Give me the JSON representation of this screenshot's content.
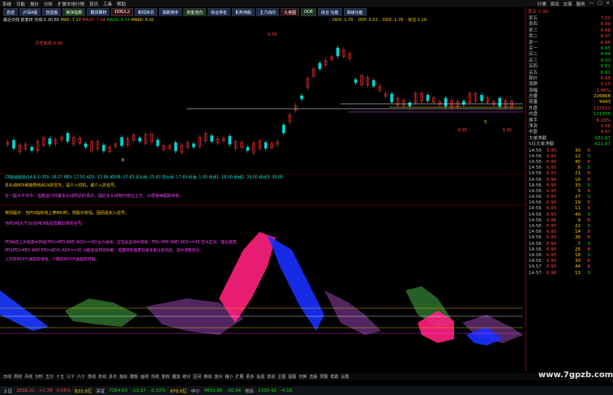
{
  "menubar": {
    "items": [
      "系统",
      "功能",
      "报价",
      "分析",
      "扩展市场行情",
      "资讯",
      "工具",
      "帮助"
    ],
    "window_controls": [
      "行情",
      "资讯",
      "交易",
      "服务",
      "—",
      "□",
      "×"
    ]
  },
  "tabs": [
    "自选",
    "沪深A股",
    "自选股",
    "板块指数",
    "期货期权",
    "DDE/L2",
    "新闻资讯",
    "涨跌排序",
    "资金流向",
    "综合排名",
    "机构持股",
    "主力动向",
    "九宫图",
    "DDE",
    "综合 功能",
    "高级功能"
  ],
  "info": {
    "name": "最近日线",
    "rows": "前复权 均线:5 30 60",
    "ma1": "MA5: 7.17",
    "ma2": "MA10: 7.04",
    "ma3": "MA20: 6.54",
    "ma4": "MA60: 6.91"
  },
  "dataline": [
    "DDX: 1.70",
    "DDY: 0.03",
    "DDZ: 1.76",
    "标注:1.16"
  ],
  "chart_annotations": {
    "red1": "历史新高:9.39",
    "red2": "9.39",
    "yellow_b": "B",
    "yellow_s": "S",
    "low1": "6.95",
    "low2": "6.95"
  },
  "indicator_header": "CR超级趋势(14,6,1)  PDI: 28.37  MDI: 17.93  ADX: 17.98  ADXR: 17.83  多头线: 25.83  空头线: 17.49  标准: 1.00  标线1: 16.00  标线2: 20.00  标线3: 30.00",
  "notes": [
    "多头线MDI和趋势线ADX的交叉，是介入时机，或介入的信号。",
    "在一般大牛市中，指数运行时做多头线附近的顶点，因此多头线有时候在上方，以便继续跟踪持有。",
    "特别提示：当PDI指标线上穿MDI时，则股价较强，因而是买入信号。",
    "当PDI线大于20及MDI线是短期出场的信号。"
  ],
  "lower_notes": [
    "PDI线在上升趋势中持续(PDI>MDI AND ADX>=30)主力进场，应在此区间中持有，PDI<MDI AND ADX>=30 空头区间，建议观望。",
    "PDI(PDI>MDI AND PDI<ADX) ADX>=30 对趋势反转的判断，提醒持有股票的投资者注意风险，及时调整持仓。",
    "上升的ADX代表趋势增强，下降的ADX代表趋势转弱。"
  ],
  "right_panel": {
    "code_title": "卖五 7.00",
    "quote": [
      {
        "k": "卖五",
        "v": "7.00"
      },
      {
        "k": "卖四",
        "v": "6.99"
      },
      {
        "k": "卖三",
        "v": "6.98"
      },
      {
        "k": "卖二",
        "v": "6.97"
      },
      {
        "k": "卖一",
        "v": "6.96"
      },
      {
        "k": "买一",
        "v": "6.95"
      },
      {
        "k": "买二",
        "v": "6.94"
      },
      {
        "k": "买三",
        "v": "6.93"
      },
      {
        "k": "买四",
        "v": "6.92"
      },
      {
        "k": "买五",
        "v": "6.91"
      }
    ],
    "stats": [
      {
        "k": "现价",
        "v": "6.95"
      },
      {
        "k": "涨跌",
        "v": "0.10"
      },
      {
        "k": "涨幅",
        "v": "1.46%"
      },
      {
        "k": "总量",
        "v": "226868"
      },
      {
        "k": "现量",
        "v": "9943"
      },
      {
        "k": "外盘",
        "v": "115513"
      },
      {
        "k": "内盘",
        "v": "111355"
      },
      {
        "k": "换手",
        "v": "6.26%"
      },
      {
        "k": "净资",
        "v": "3.06"
      },
      {
        "k": "市盈",
        "v": "4.07"
      }
    ],
    "flows": [
      {
        "k": "大单净额",
        "v": "-551.67"
      },
      {
        "k": "5日大单净额",
        "v": "-621.67"
      }
    ],
    "ticks": [
      {
        "t": "14:56",
        "p": "6.95",
        "v": "30",
        "s": "B"
      },
      {
        "t": "14:56",
        "p": "6.95",
        "v": "12",
        "s": "S"
      },
      {
        "t": "14:56",
        "p": "6.96",
        "v": "45",
        "s": "B"
      },
      {
        "t": "14:56",
        "p": "6.95",
        "v": "8",
        "s": "S"
      },
      {
        "t": "14:56",
        "p": "6.95",
        "v": "21",
        "s": "B"
      },
      {
        "t": "14:56",
        "p": "6.96",
        "v": "16",
        "s": "B"
      },
      {
        "t": "14:56",
        "p": "6.95",
        "v": "33",
        "s": "S"
      },
      {
        "t": "14:56",
        "p": "6.95",
        "v": "5",
        "s": "B"
      },
      {
        "t": "14:56",
        "p": "6.95",
        "v": "27",
        "s": "S"
      },
      {
        "t": "14:56",
        "p": "6.96",
        "v": "19",
        "s": "B"
      },
      {
        "t": "14:56",
        "p": "6.95",
        "v": "11",
        "s": "B"
      },
      {
        "t": "14:56",
        "p": "6.95",
        "v": "40",
        "s": "S"
      },
      {
        "t": "14:56",
        "p": "6.96",
        "v": "9",
        "s": "B"
      },
      {
        "t": "14:56",
        "p": "6.95",
        "v": "22",
        "s": "S"
      },
      {
        "t": "14:56",
        "p": "6.95",
        "v": "14",
        "s": "B"
      },
      {
        "t": "14:56",
        "p": "6.95",
        "v": "36",
        "s": "B"
      },
      {
        "t": "14:56",
        "p": "6.96",
        "v": "7",
        "s": "S"
      },
      {
        "t": "14:56",
        "p": "6.95",
        "v": "25",
        "s": "B"
      },
      {
        "t": "14:56",
        "p": "6.95",
        "v": "18",
        "s": "S"
      },
      {
        "t": "14:56",
        "p": "6.95",
        "v": "30",
        "s": "B"
      },
      {
        "t": "14:57",
        "p": "6.95",
        "v": "44",
        "s": "B"
      },
      {
        "t": "14:57",
        "p": "6.96",
        "v": "13",
        "s": "S"
      }
    ]
  },
  "taskbar": [
    "日线",
    "周线",
    "月线",
    "分时",
    "五分",
    "十五",
    "三十",
    "六十",
    "季线",
    "年线",
    "多日",
    "指标",
    "模板",
    "画线",
    "均线",
    "复权",
    "叠加",
    "统计",
    "区间",
    "移动",
    "放大",
    "缩小",
    "扩展",
    "更多",
    "后退",
    "前进",
    "主图",
    "副图",
    "切换",
    "选股",
    "预警",
    "帮助",
    "设置"
  ],
  "statusbar": [
    {
      "t": "上证",
      "c": ""
    },
    {
      "t": "2838.21",
      "c": "r"
    },
    {
      "t": "+1.39",
      "c": "r"
    },
    {
      "t": "0.05%",
      "c": "r"
    },
    {
      "t": "822.0亿",
      "c": "y"
    },
    {
      "t": "深证",
      "c": ""
    },
    {
      "t": "7264.63",
      "c": "g"
    },
    {
      "t": "-23.37",
      "c": "g"
    },
    {
      "t": "-0.32%",
      "c": "g"
    },
    {
      "t": "970.0亿",
      "c": "y"
    },
    {
      "t": "中小",
      "c": ""
    },
    {
      "t": "4651.86",
      "c": "g"
    },
    {
      "t": "-30.94",
      "c": "g"
    },
    {
      "t": "创业",
      "c": ""
    },
    {
      "t": "1330.42",
      "c": "g"
    },
    {
      "t": "-4.18",
      "c": "g"
    }
  ],
  "watermark": "www.7gpzb.com"
}
